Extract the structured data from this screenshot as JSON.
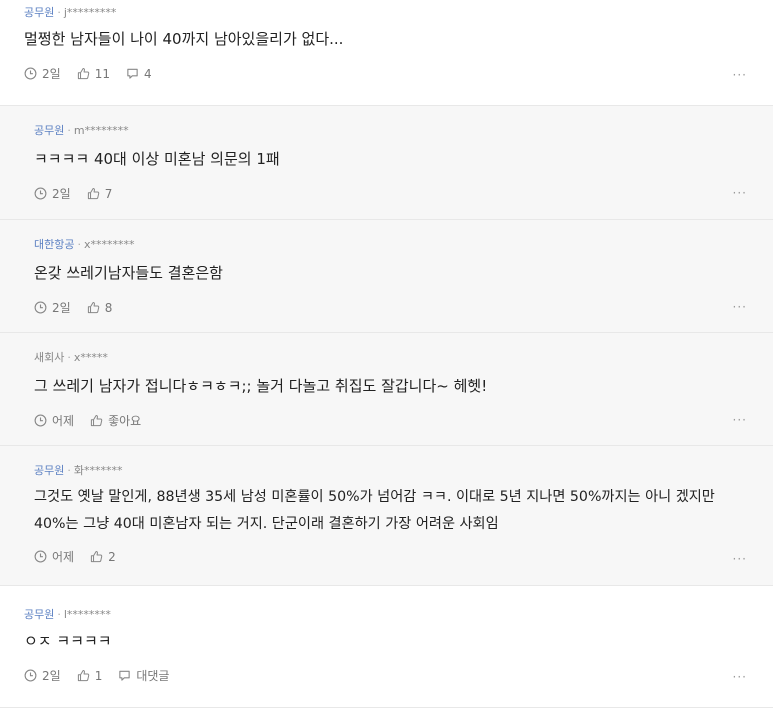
{
  "comments": [
    {
      "company": "공무원",
      "user": "j*********",
      "text": "멀쩡한 남자들이 나이 40까지 남아있을리가 없다...",
      "time": "2일",
      "likes": "11",
      "replies": "4"
    },
    {
      "company": "공무원",
      "user": "m********",
      "text": "ㅋㅋㅋㅋ 40대 이상 미혼남 의문의 1패",
      "time": "2일",
      "likes": "7"
    },
    {
      "company": "대한항공",
      "user": "x********",
      "text": "온갖 쓰레기남자들도 결혼은함",
      "time": "2일",
      "likes": "8"
    },
    {
      "company": "새회사",
      "user": "x*****",
      "text": "그 쓰레기 남자가 접니다ㅎㅋㅎㅋ;; 놀거 다놀고 취집도 잘갑니다~ 헤헷!",
      "time": "어제",
      "likes": "좋아요"
    },
    {
      "company": "공무원",
      "user": "화*******",
      "text": "그것도 옛날 말인게, 88년생 35세 남성 미혼률이 50%가 넘어감 ㅋㅋ. 이대로 5년 지나면 50%까지는 아니 겠지만 40%는 그냥 40대 미혼남자 되는 거지. 단군이래 결혼하기 가장 어려운 사회임",
      "time": "어제",
      "likes": "2"
    },
    {
      "company": "공무원",
      "user": "l********",
      "text": "ㅇㅈ ㅋㅋㅋㅋ",
      "time": "2일",
      "likes": "1",
      "replies": "대댓글"
    }
  ],
  "separator": "·",
  "more_label": "···",
  "colors": {
    "company_link": "#5a7fc2",
    "reply_bg": "#f7f7f7",
    "divider": "#e8e8e8"
  },
  "icons": {
    "time": "clock-icon",
    "like": "thumbs-up-icon",
    "reply": "speech-bubble-icon",
    "more": "more-dots-icon"
  }
}
